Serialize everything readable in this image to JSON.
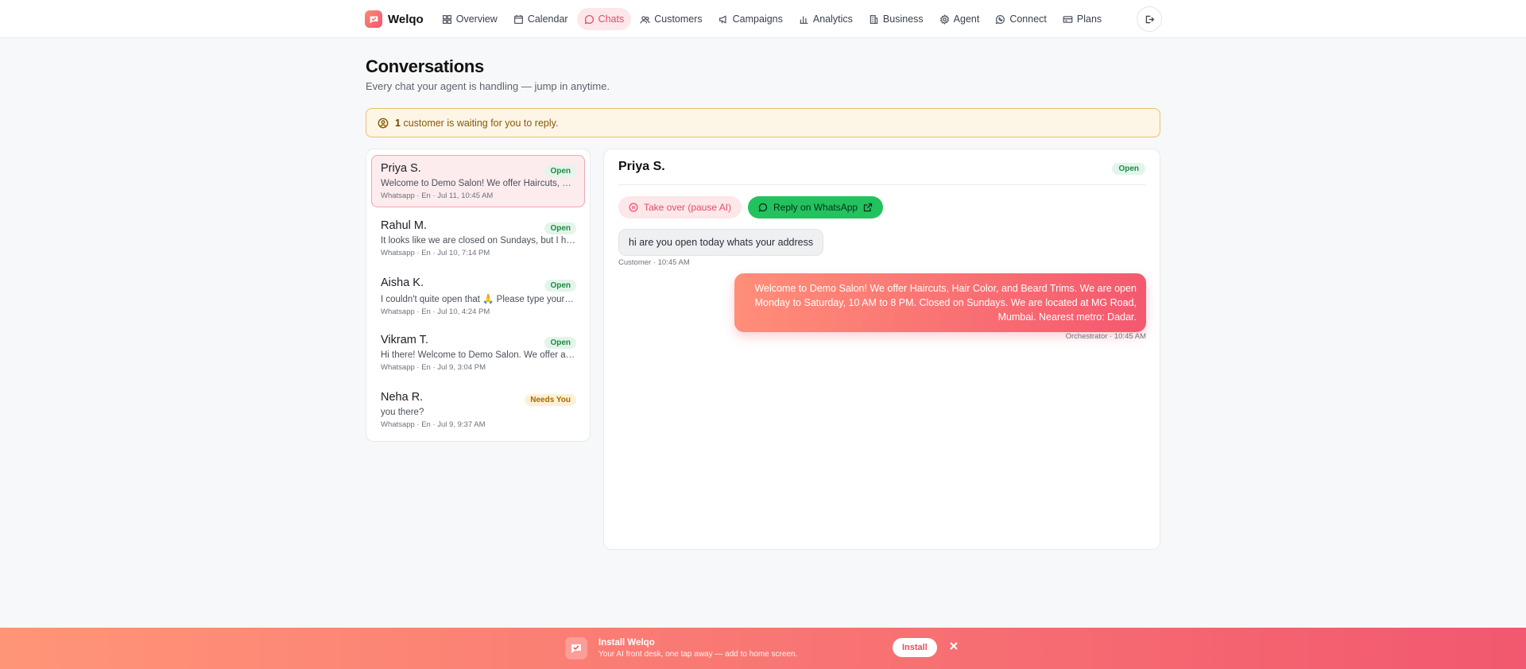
{
  "app": {
    "name": "Welqo",
    "accent_color": "#f2546e"
  },
  "nav": {
    "items": [
      {
        "label": "Overview",
        "icon": "grid-icon"
      },
      {
        "label": "Calendar",
        "icon": "calendar-icon"
      },
      {
        "label": "Chats",
        "icon": "chat-bubble-icon",
        "active": true
      },
      {
        "label": "Customers",
        "icon": "users-icon"
      },
      {
        "label": "Campaigns",
        "icon": "megaphone-icon"
      },
      {
        "label": "Analytics",
        "icon": "bar-chart-icon"
      },
      {
        "label": "Business",
        "icon": "building-icon"
      },
      {
        "label": "Agent",
        "icon": "gear-icon"
      },
      {
        "label": "Connect",
        "icon": "whatsapp-icon"
      },
      {
        "label": "Plans",
        "icon": "credit-card-icon"
      }
    ],
    "logout_icon": "logout-icon"
  },
  "header": {
    "title": "Conversations",
    "subtitle": "Every chat your agent is handling — jump in anytime."
  },
  "banner": {
    "count": "1",
    "text": "customer is waiting for you to reply.",
    "icon": "user-circle-icon"
  },
  "conversations": [
    {
      "name": "Priya S.",
      "status": "Open",
      "preview": "Welcome to Demo Salon! We offer Haircuts, Hair Color, and Beard Trims.",
      "meta": "Whatsapp · En · Jul 11, 10:45 AM",
      "selected": true
    },
    {
      "name": "Rahul M.",
      "status": "Open",
      "preview": "It looks like we are closed on Sundays, but I hope to see you soon.",
      "meta": "Whatsapp · En · Jul 10, 7:14 PM"
    },
    {
      "name": "Aisha K.",
      "status": "Open",
      "preview": "I couldn't quite open that 🙏 Please type your question.",
      "meta": "Whatsapp · En · Jul 10, 4:24 PM"
    },
    {
      "name": "Vikram T.",
      "status": "Open",
      "preview": "Hi there! Welcome to Demo Salon. We offer a range of services.",
      "meta": "Whatsapp · En · Jul 9, 3:04 PM"
    },
    {
      "name": "Neha R.",
      "status": "Needs You",
      "preview": "you there?",
      "meta": "Whatsapp · En · Jul 9, 9:37 AM"
    }
  ],
  "chat": {
    "name": "Priya S.",
    "status": "Open",
    "takeover_label": "Take over (pause AI)",
    "whatsapp_label": "Reply on WhatsApp",
    "messages": [
      {
        "from": "customer",
        "text": "hi are you open today whats your address",
        "meta": "Customer · 10:45 AM"
      },
      {
        "from": "agent",
        "text": "Welcome to Demo Salon! We offer Haircuts, Hair Color, and Beard Trims. We are open Monday to Saturday, 10 AM to 8 PM. Closed on Sundays. We are located at MG Road, Mumbai. Nearest metro: Dadar.",
        "meta": "Orchestrator · 10:45 AM"
      }
    ]
  },
  "install": {
    "title": "Install Welqo",
    "subtitle": "Your AI front desk, one tap away — add to home screen.",
    "button_label": "Install",
    "close_icon": "close-icon"
  }
}
